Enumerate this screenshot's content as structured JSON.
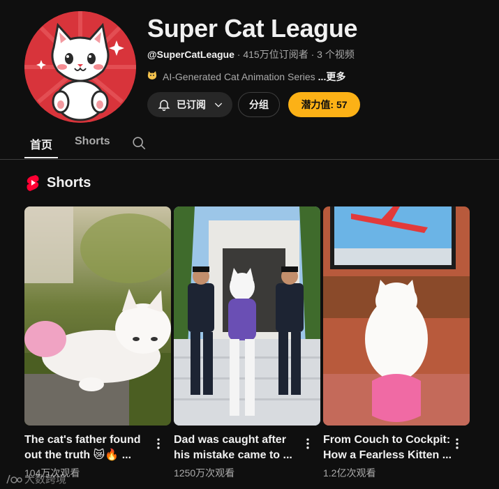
{
  "channel": {
    "name": "Super Cat League",
    "handle": "@SuperCatLeague",
    "stats": " · 415万位订阅者 · 3 个视频",
    "description": "AI-Generated Cat Animation Series",
    "more_label": "...更多",
    "avatar_icon": "cat-mascot-icon",
    "desc_emoji_icon": "cat-face-icon"
  },
  "buttons": {
    "subscribed_label": "已订阅",
    "group_label": "分组",
    "potential_label": "潜力值: 57"
  },
  "tabs": {
    "home": "首页",
    "shorts": "Shorts",
    "search_icon": "search-icon"
  },
  "section": {
    "title": "Shorts"
  },
  "cards": [
    {
      "title_line1": "The cat's father found",
      "title_line2": "out the truth 😿🔥 ...",
      "views": "104万次观看",
      "thumb": "white kitten lying on grass"
    },
    {
      "title_line1": "Dad was caught after",
      "title_line2": "his mistake came to ...",
      "views": "1250万次观看",
      "thumb": "cat in handcuffs escorted by police"
    },
    {
      "title_line1": "From Couch to Cockpit:",
      "title_line2": "How a Fearless Kitten ...",
      "views": "1.2亿次观看",
      "thumb": "kitten watching airplane on TV"
    }
  ],
  "watermark": "大数跨境",
  "colors": {
    "background": "#0f0f0f",
    "potential_button": "#fcb116",
    "shorts_logo": "#ff0033",
    "avatar_bg": "#d8343b"
  }
}
